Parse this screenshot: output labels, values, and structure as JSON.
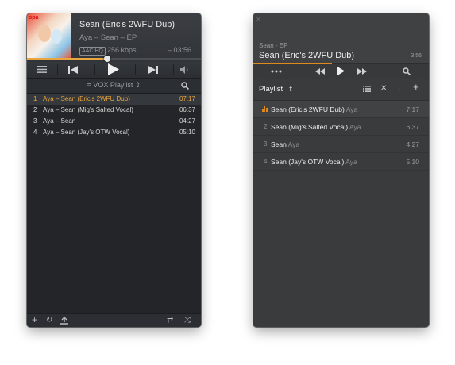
{
  "left_player": {
    "track_title": "Sean (Eric's 2WFU Dub)",
    "track_subtitle": "Aya – Sean – EP",
    "format_badge": "AAC HQ",
    "bitrate": "256 kbps",
    "time_remaining": "– 03:56",
    "progress": 0.46,
    "playlist_name": "VOX Playlist",
    "tracks": [
      {
        "num": "1",
        "title": "Aya – Sean (Eric's 2WFU Dub)",
        "duration": "07:17",
        "playing": true
      },
      {
        "num": "2",
        "title": "Aya – Sean (Mig's Salted Vocal)",
        "duration": "06:37",
        "playing": false
      },
      {
        "num": "3",
        "title": "Aya – Sean",
        "duration": "04:27",
        "playing": false
      },
      {
        "num": "4",
        "title": "Aya – Sean (Jay's OTW Vocal)",
        "duration": "05:10",
        "playing": false
      }
    ],
    "accent_color": "#e9a63f",
    "icons": [
      "menu-icon",
      "previous-icon",
      "play-icon",
      "next-icon",
      "volume-icon",
      "search-icon",
      "add-icon",
      "refresh-icon",
      "upload-icon",
      "repeat-icon",
      "shuffle-icon"
    ]
  },
  "right_player": {
    "album": "Sean - EP",
    "track_title": "Sean (Eric's 2WFU Dub)",
    "time_remaining": "– 3:56",
    "progress": 0.45,
    "playlist_label": "Playlist",
    "tracks": [
      {
        "num": "",
        "title": "Sean (Eric's 2WFU Dub)",
        "artist": "Aya",
        "duration": "7:17",
        "playing": true
      },
      {
        "num": "2",
        "title": "Sean (Mig's Salted Vocal)",
        "artist": "Aya",
        "duration": "6:37",
        "playing": false
      },
      {
        "num": "3",
        "title": "Sean",
        "artist": "Aya",
        "duration": "4:27",
        "playing": false
      },
      {
        "num": "4",
        "title": "Sean (Jay's OTW Vocal)",
        "artist": "Aya",
        "duration": "5:10",
        "playing": false
      }
    ],
    "accent_color": "#e08a1e",
    "icons": [
      "more-icon",
      "rewind-icon",
      "play-icon",
      "fast-forward-icon",
      "search-icon",
      "list-icon",
      "close-icon",
      "download-icon",
      "add-icon"
    ]
  }
}
